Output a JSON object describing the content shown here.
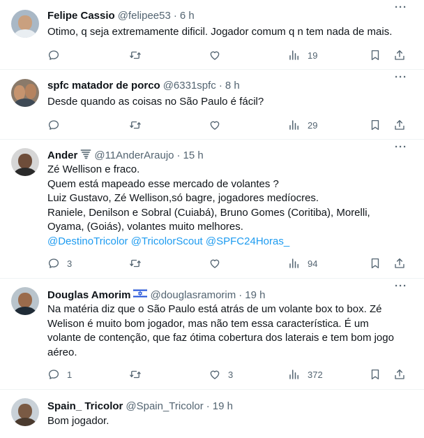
{
  "tweets": [
    {
      "name": "Felipe Cassio",
      "handle": "@felipee53",
      "sep": "·",
      "time": "6 h",
      "lines": [
        "Otimo, q seja extremamente dificil. Jogador comum q n tem nada de mais."
      ],
      "mentions": "",
      "replies": "",
      "retweets": "",
      "likes": "",
      "views": "19"
    },
    {
      "name": "spfc matador de porco",
      "handle": "@6331spfc",
      "sep": "·",
      "time": "8 h",
      "lines": [
        "Desde quando as coisas no São Paulo é fácil?"
      ],
      "mentions": "",
      "replies": "",
      "retweets": "",
      "likes": "",
      "views": "29"
    },
    {
      "name": "Ander",
      "handle": "@11AnderAraujo",
      "sep": "·",
      "time": "15 h",
      "lines": [
        "Zé Wellison e fraco.",
        "Quem está mapeado esse mercado de volantes ?",
        "Luiz Gustavo, Zé Wellison,só bagre, jogadores medíocres.",
        "Raniele, Denilson e Sobral (Cuiabá), Bruno Gomes (Coritiba), Morelli,",
        "Oyama, (Goiás), volantes muito melhores."
      ],
      "mentions": "@DestinoTricolor @TricolorScout @SPFC24Horas_",
      "replies": "3",
      "retweets": "",
      "likes": "",
      "views": "94"
    },
    {
      "name": "Douglas Amorim",
      "handle": "@douglasramorim",
      "sep": "·",
      "time": "19 h",
      "lines": [
        "Na matéria diz que o São Paulo está atrás de um volante box to box. Zé",
        "Welison é muito bom jogador, mas não tem essa característica. É um",
        "volante de contenção, que faz ótima cobertura dos laterais e tem bom jogo",
        "aéreo."
      ],
      "mentions": "",
      "replies": "1",
      "retweets": "",
      "likes": "3",
      "views": "372"
    },
    {
      "name": "Spain_ Tricolor",
      "handle": "@Spain_Tricolor",
      "sep": "·",
      "time": "19 h",
      "lines": [
        "Bom jogador."
      ],
      "mentions": "",
      "replies": "",
      "retweets": "",
      "likes": "",
      "views": ""
    }
  ],
  "more_label": "···",
  "colors": {
    "text": "#0f1419",
    "secondary": "#536471",
    "link": "#1d9bf0",
    "divider": "#eff3f4"
  },
  "icons": [
    "reply-icon",
    "retweet-icon",
    "like-icon",
    "views-icon",
    "bookmark-icon",
    "share-icon",
    "tornado-icon",
    "israel-flag-icon"
  ]
}
